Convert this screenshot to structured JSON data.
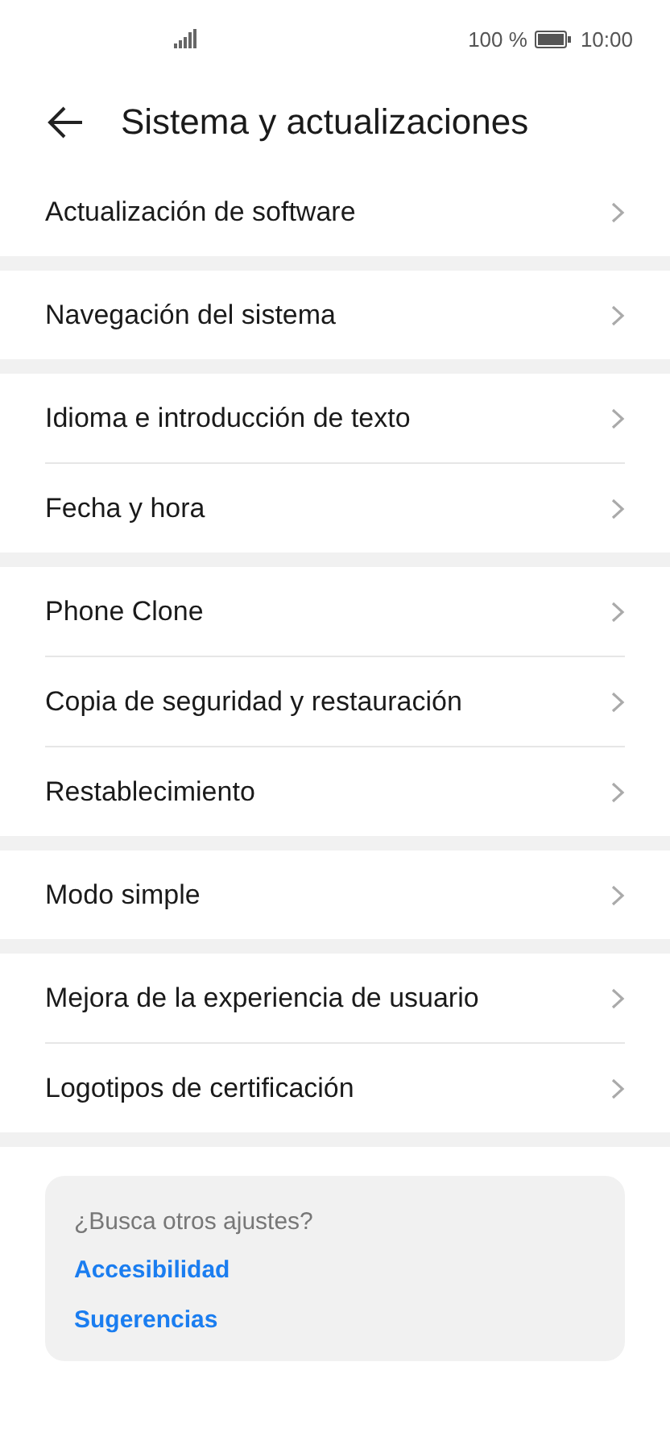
{
  "status_bar": {
    "battery_text": "100 %",
    "time": "10:00"
  },
  "header": {
    "title": "Sistema y actualizaciones"
  },
  "groups": [
    {
      "items": [
        "Actualización de software"
      ]
    },
    {
      "items": [
        "Navegación del sistema"
      ]
    },
    {
      "items": [
        "Idioma e introducción de texto",
        "Fecha y hora"
      ]
    },
    {
      "items": [
        "Phone Clone",
        "Copia de seguridad y restauración",
        "Restablecimiento"
      ]
    },
    {
      "items": [
        "Modo simple"
      ]
    },
    {
      "items": [
        "Mejora de la experiencia de usuario",
        "Logotipos de certificación"
      ]
    }
  ],
  "suggestions": {
    "question": "¿Busca otros ajustes?",
    "links": [
      "Accesibilidad",
      "Sugerencias"
    ]
  }
}
